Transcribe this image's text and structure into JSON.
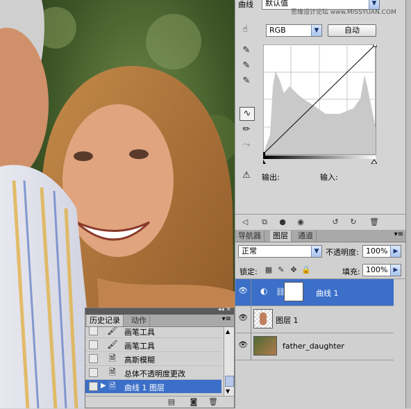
{
  "watermark": "思缘设计论坛 www.MISSYUAN.COM",
  "curves_panel": {
    "title": "曲线",
    "preset": "默认值",
    "channel": "RGB",
    "auto_button": "自动",
    "output_label": "输出:",
    "input_label": "输入:"
  },
  "layers_panel": {
    "tabs": [
      "导航器",
      "图层",
      "通道"
    ],
    "blend_mode": "正常",
    "opacity_label": "不透明度:",
    "opacity_value": "100%",
    "lock_label": "锁定:",
    "fill_label": "填充:",
    "fill_value": "100%",
    "layers": [
      {
        "name": "曲线 1",
        "selected": true
      },
      {
        "name": "图层 1",
        "selected": false
      },
      {
        "name": "father_daughter",
        "selected": false
      }
    ]
  },
  "history_panel": {
    "tabs": [
      "历史记录",
      "动作"
    ],
    "items": [
      {
        "label": "画笔工具",
        "icon": "brush-icon"
      },
      {
        "label": "画笔工具",
        "icon": "brush-icon"
      },
      {
        "label": "高斯模糊",
        "icon": "document-icon"
      },
      {
        "label": "总体不透明度更改",
        "icon": "document-icon"
      },
      {
        "label": "曲线 1 图层",
        "icon": "document-icon"
      }
    ],
    "selected_index": 4
  },
  "colors": {
    "selection": "#3b6fc8",
    "panel_bg": "#d4d4d4"
  }
}
